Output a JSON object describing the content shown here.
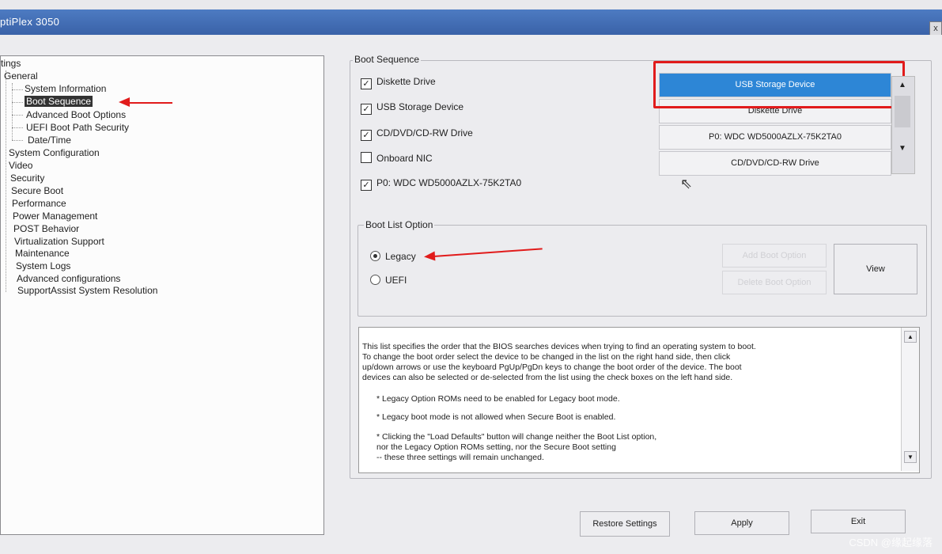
{
  "window": {
    "title": "ptiPlex 3050",
    "close_glyph": "x"
  },
  "tree": {
    "root": "tings",
    "items": [
      {
        "label": "General"
      },
      {
        "label": "System Information"
      },
      {
        "label": "Boot Sequence",
        "selected": true
      },
      {
        "label": "Advanced Boot Options"
      },
      {
        "label": "UEFI Boot Path Security"
      },
      {
        "label": "Date/Time"
      },
      {
        "label": "System Configuration"
      },
      {
        "label": "Video"
      },
      {
        "label": "Security"
      },
      {
        "label": "Secure Boot"
      },
      {
        "label": "Performance"
      },
      {
        "label": "Power Management"
      },
      {
        "label": "POST Behavior"
      },
      {
        "label": "Virtualization Support"
      },
      {
        "label": "Maintenance"
      },
      {
        "label": "System Logs"
      },
      {
        "label": "Advanced configurations"
      },
      {
        "label": "SupportAssist System Resolution"
      }
    ]
  },
  "boot_sequence": {
    "legend": "Boot Sequence",
    "devices": [
      {
        "label": "Diskette Drive",
        "checked": true,
        "mark": "✓"
      },
      {
        "label": "USB Storage Device",
        "checked": true,
        "mark": "✓"
      },
      {
        "label": "CD/DVD/CD-RW Drive",
        "checked": true,
        "mark": "✓"
      },
      {
        "label": "Onboard NIC",
        "checked": false,
        "mark": ""
      },
      {
        "label": "P0: WDC WD5000AZLX-75K2TA0",
        "checked": true,
        "mark": "✓"
      }
    ],
    "order": [
      "USB Storage Device",
      "Diskette Drive",
      "P0: WDC WD5000AZLX-75K2TA0",
      "CD/DVD/CD-RW Drive"
    ],
    "scroll_up": "▲",
    "scroll_down": "▼"
  },
  "boot_list": {
    "legend": "Boot List Option",
    "options": [
      {
        "label": "Legacy",
        "selected": true
      },
      {
        "label": "UEFI",
        "selected": false
      }
    ],
    "add_label": "Add Boot Option",
    "delete_label": "Delete Boot Option",
    "view_label": "View"
  },
  "help": {
    "paragraph": "This list specifies the order that the BIOS searches devices when trying to find an operating system to boot.\nTo change the boot order select the device to be changed in the list on the right hand side, then click\nup/down arrows or use the keyboard PgUp/PgDn keys to change the boot order of the device. The boot\ndevices can also be selected or de-selected from the list using the check boxes on the left hand side.",
    "note1": "* Legacy Option ROMs need to be enabled for Legacy boot mode.",
    "note2": "* Legacy boot mode is not allowed when Secure Boot is enabled.",
    "note3": "* Clicking the \"Load Defaults\" button will change neither the Boot List option,\n   nor the Legacy Option ROMs setting, nor the Secure Boot setting\n   -- these three settings will remain unchanged.",
    "scroll_up": "▲",
    "scroll_down": "▼"
  },
  "footer": {
    "restore": "Restore Settings",
    "apply": "Apply",
    "exit": "Exit"
  },
  "watermark": "CSDN @缘起缘落",
  "colors": {
    "selected_row": "#2d86d6",
    "annotation": "#e11b1b",
    "title_bar": "#3a62a8"
  }
}
